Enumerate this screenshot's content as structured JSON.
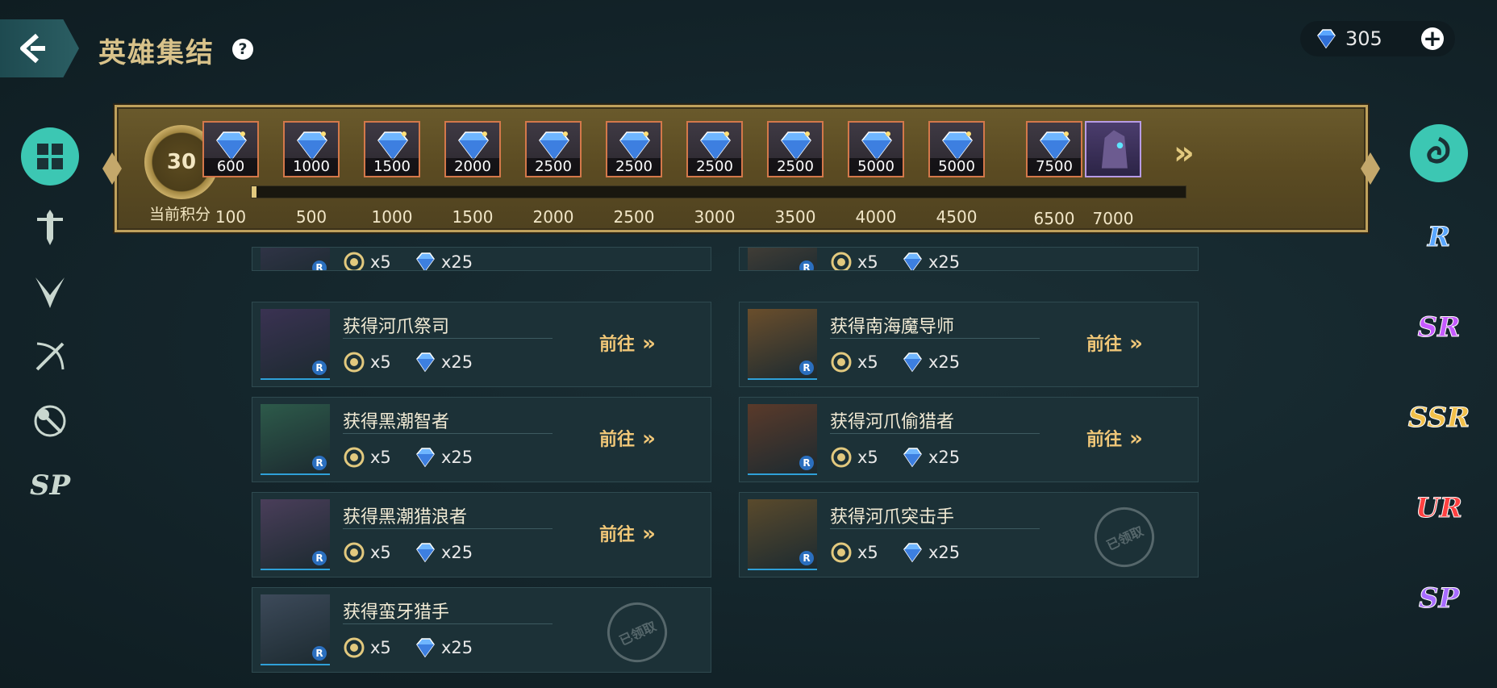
{
  "header": {
    "title": "英雄集结",
    "help_icon": "question-icon",
    "currency_amount": "305"
  },
  "left_nav": [
    {
      "name": "all-category-icon",
      "active": true
    },
    {
      "name": "warrior-class-icon"
    },
    {
      "name": "assassin-class-icon"
    },
    {
      "name": "archer-class-icon"
    },
    {
      "name": "support-class-icon"
    },
    {
      "name": "sp-class-icon"
    }
  ],
  "right_nav": [
    {
      "name": "all-rarity-icon",
      "active": true
    },
    {
      "label": "R",
      "color": "#5aa7ff"
    },
    {
      "label": "SR",
      "color": "#c65aff"
    },
    {
      "label": "SSR",
      "color": "#f2c04a"
    },
    {
      "label": "UR",
      "color": "#ff4040"
    },
    {
      "label": "SP",
      "color": "#a76bff"
    }
  ],
  "track": {
    "current_points": "30",
    "current_points_label": "当前积分",
    "progress_fraction": 0.005,
    "rewards": [
      {
        "amount": "600",
        "threshold": "100"
      },
      {
        "amount": "1000",
        "threshold": "500"
      },
      {
        "amount": "1500",
        "threshold": "1000"
      },
      {
        "amount": "2000",
        "threshold": "1500"
      },
      {
        "amount": "2500",
        "threshold": "2000"
      },
      {
        "amount": "2500",
        "threshold": "2500"
      },
      {
        "amount": "2500",
        "threshold": "3000"
      },
      {
        "amount": "2500",
        "threshold": "3500"
      },
      {
        "amount": "5000",
        "threshold": "4000"
      },
      {
        "amount": "5000",
        "threshold": "4500"
      },
      {
        "amount": "7500",
        "threshold": "6500"
      },
      {
        "amount": "",
        "threshold": "7000",
        "hero": true
      }
    ]
  },
  "tasks": [
    {
      "name": "",
      "cost_a": "x5",
      "cost_b": "x25",
      "cut": true
    },
    {
      "name": "",
      "cost_a": "x5",
      "cost_b": "x25",
      "cut": true
    },
    {
      "name": "获得河爪祭司",
      "cost_a": "x5",
      "cost_b": "x25",
      "action": "前往"
    },
    {
      "name": "获得南海魔导师",
      "cost_a": "x5",
      "cost_b": "x25",
      "action": "前往"
    },
    {
      "name": "获得黑潮智者",
      "cost_a": "x5",
      "cost_b": "x25",
      "action": "前往"
    },
    {
      "name": "获得河爪偷猎者",
      "cost_a": "x5",
      "cost_b": "x25",
      "action": "前往"
    },
    {
      "name": "获得黑潮猎浪者",
      "cost_a": "x5",
      "cost_b": "x25",
      "action": "前往"
    },
    {
      "name": "获得河爪突击手",
      "cost_a": "x5",
      "cost_b": "x25",
      "claimed": "已领取"
    },
    {
      "name": "获得蛮牙猎手",
      "cost_a": "x5",
      "cost_b": "x25",
      "claimed": "已领取"
    }
  ]
}
